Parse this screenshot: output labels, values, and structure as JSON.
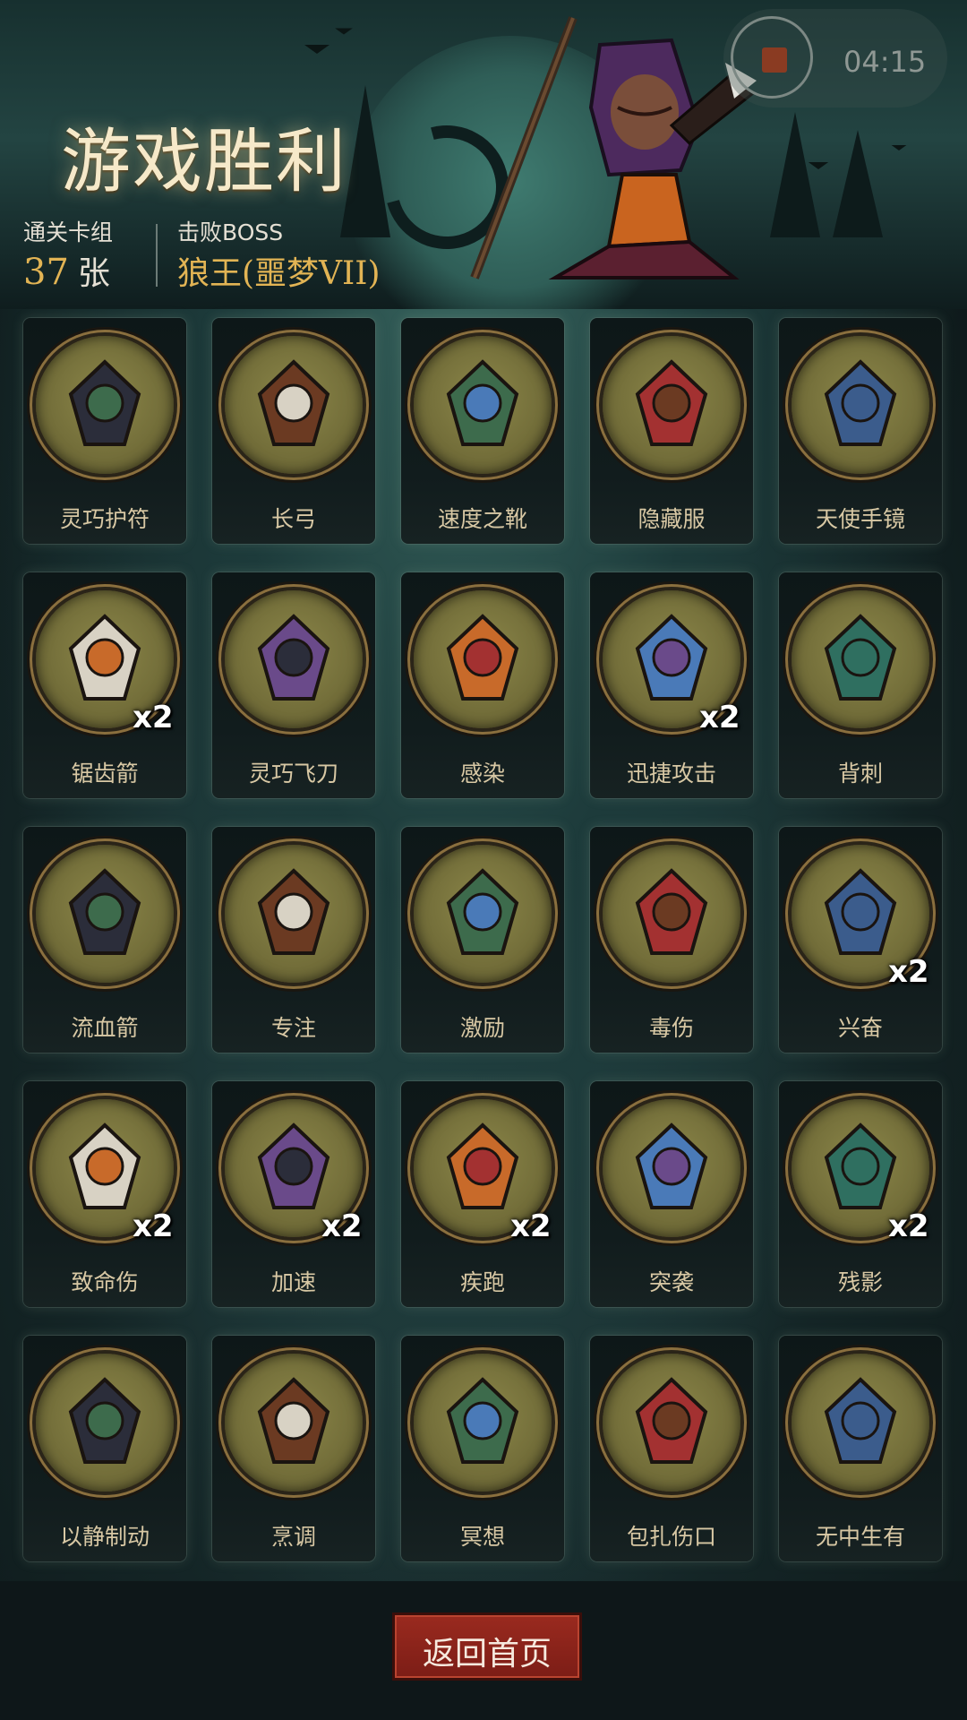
{
  "header": {
    "title": "游戏胜利",
    "stats": [
      {
        "label": "通关卡组",
        "value": "37",
        "unit": "张"
      },
      {
        "label": "击败BOSS",
        "value": "狼王(噩梦VII)"
      }
    ]
  },
  "timer": {
    "time": "04:15",
    "icon": "stop-record-icon"
  },
  "cards": [
    {
      "name": "灵巧护符",
      "count": "",
      "icon": "amulet-icon"
    },
    {
      "name": "长弓",
      "count": "",
      "icon": "longbow-icon"
    },
    {
      "name": "速度之靴",
      "count": "",
      "icon": "boot-icon"
    },
    {
      "name": "隐藏服",
      "count": "",
      "icon": "hooded-cloak-icon"
    },
    {
      "name": "天使手镜",
      "count": "",
      "icon": "hand-mirror-icon"
    },
    {
      "name": "锯齿箭",
      "count": "x2",
      "icon": "serrated-arrow-icon"
    },
    {
      "name": "灵巧飞刀",
      "count": "",
      "icon": "flying-knives-icon"
    },
    {
      "name": "感染",
      "count": "",
      "icon": "infected-monster-icon"
    },
    {
      "name": "迅捷攻击",
      "count": "x2",
      "icon": "swift-strike-icon"
    },
    {
      "name": "背刺",
      "count": "",
      "icon": "backstab-icon"
    },
    {
      "name": "流血箭",
      "count": "",
      "icon": "bleeding-arrows-icon"
    },
    {
      "name": "专注",
      "count": "",
      "icon": "wizard-icon"
    },
    {
      "name": "激励",
      "count": "",
      "icon": "hammer-warrior-icon"
    },
    {
      "name": "毒伤",
      "count": "",
      "icon": "poison-tentacle-icon"
    },
    {
      "name": "兴奋",
      "count": "x2",
      "icon": "excited-dwarf-icon"
    },
    {
      "name": "致命伤",
      "count": "x2",
      "icon": "bloody-dagger-icon"
    },
    {
      "name": "加速",
      "count": "x2",
      "icon": "witch-broom-icon"
    },
    {
      "name": "疾跑",
      "count": "x2",
      "icon": "sprinting-beast-icon"
    },
    {
      "name": "突袭",
      "count": "",
      "icon": "raider-icon"
    },
    {
      "name": "残影",
      "count": "x2",
      "icon": "afterimage-icon"
    },
    {
      "name": "以静制动",
      "count": "",
      "icon": "skull-flame-icon"
    },
    {
      "name": "烹调",
      "count": "",
      "icon": "fox-cook-icon"
    },
    {
      "name": "冥想",
      "count": "",
      "icon": "meditation-icon"
    },
    {
      "name": "包扎伤口",
      "count": "",
      "icon": "plague-doctor-icon"
    },
    {
      "name": "无中生有",
      "count": "",
      "icon": "magic-book-icon"
    }
  ],
  "footer": {
    "button_label": "返回首页"
  }
}
